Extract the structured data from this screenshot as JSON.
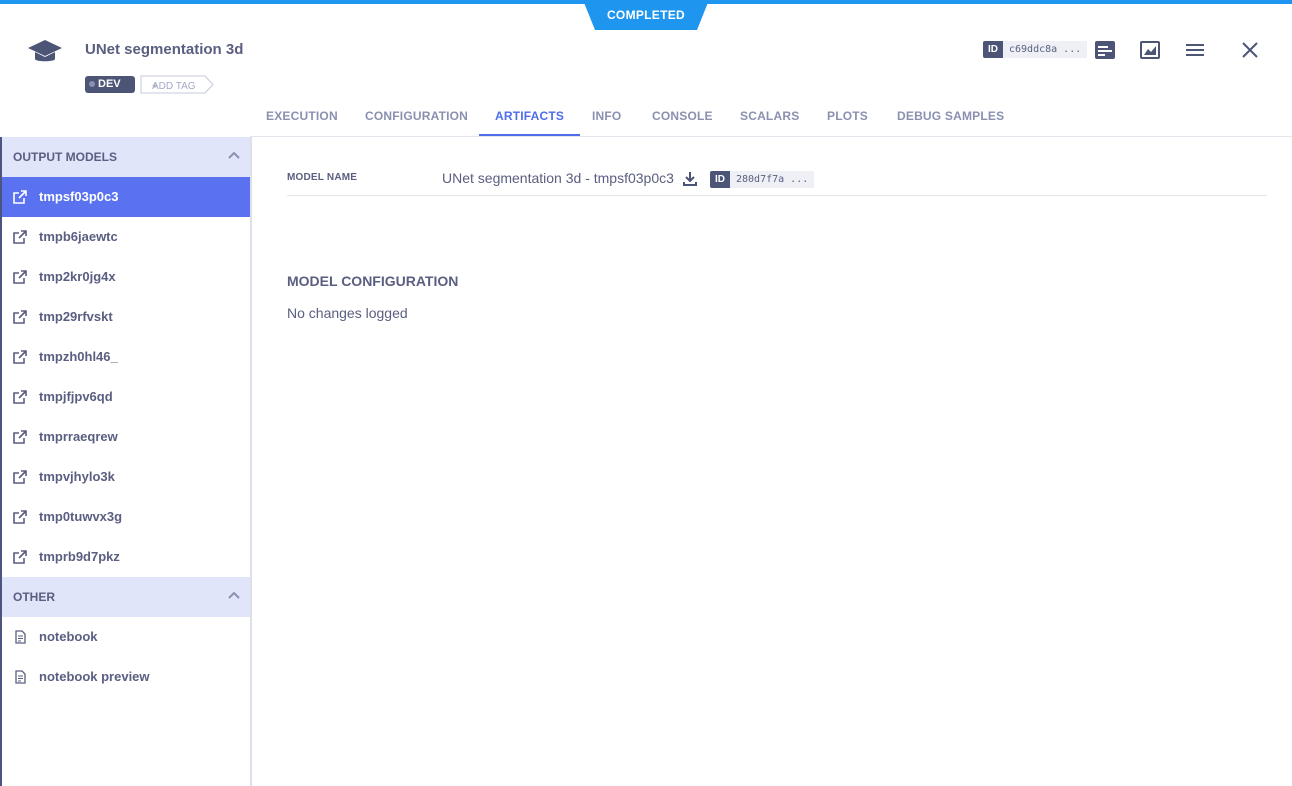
{
  "status": {
    "label": "COMPLETED",
    "color": "#1e96f0"
  },
  "header": {
    "icon": "graduation-cap-icon",
    "title": "UNet segmentation 3d",
    "tags": [
      "DEV"
    ],
    "add_tag_label": "ADD TAG",
    "id_label": "ID",
    "id_value": "c69ddc8a ...",
    "actions": [
      "details-icon",
      "chart-icon",
      "menu-icon",
      "close-icon"
    ]
  },
  "tabs": [
    {
      "label": "EXECUTION",
      "active": false
    },
    {
      "label": "CONFIGURATION",
      "active": false
    },
    {
      "label": "ARTIFACTS",
      "active": true
    },
    {
      "label": "INFO",
      "active": false
    },
    {
      "label": "CONSOLE",
      "active": false
    },
    {
      "label": "SCALARS",
      "active": false
    },
    {
      "label": "PLOTS",
      "active": false
    },
    {
      "label": "DEBUG SAMPLES",
      "active": false
    }
  ],
  "sidebar": {
    "sections": [
      {
        "title": "OUTPUT MODELS",
        "items": [
          {
            "label": "tmpsf03p0c3",
            "icon": "external-link-icon",
            "active": true
          },
          {
            "label": "tmpb6jaewtc",
            "icon": "external-link-icon"
          },
          {
            "label": "tmp2kr0jg4x",
            "icon": "external-link-icon"
          },
          {
            "label": "tmp29rfvskt",
            "icon": "external-link-icon"
          },
          {
            "label": "tmpzh0hl46_",
            "icon": "external-link-icon"
          },
          {
            "label": "tmpjfjpv6qd",
            "icon": "external-link-icon"
          },
          {
            "label": "tmprraeqrew",
            "icon": "external-link-icon"
          },
          {
            "label": "tmpvjhylo3k",
            "icon": "external-link-icon"
          },
          {
            "label": "tmp0tuwvx3g",
            "icon": "external-link-icon"
          },
          {
            "label": "tmprb9d7pkz",
            "icon": "external-link-icon"
          }
        ]
      },
      {
        "title": "OTHER",
        "items": [
          {
            "label": "notebook",
            "icon": "document-icon"
          },
          {
            "label": "notebook preview",
            "icon": "document-icon"
          }
        ]
      }
    ]
  },
  "main": {
    "model_name_label": "MODEL NAME",
    "model_name_value": "UNet segmentation 3d - tmpsf03p0c3",
    "model_id_label": "ID",
    "model_id_value": "280d7f7a ...",
    "config_title": "MODEL CONFIGURATION",
    "config_text": "No changes logged"
  },
  "colors": {
    "accent": "#5a72f0",
    "tab_active": "#4d6dea",
    "section_bg": "#e1e5f9"
  }
}
